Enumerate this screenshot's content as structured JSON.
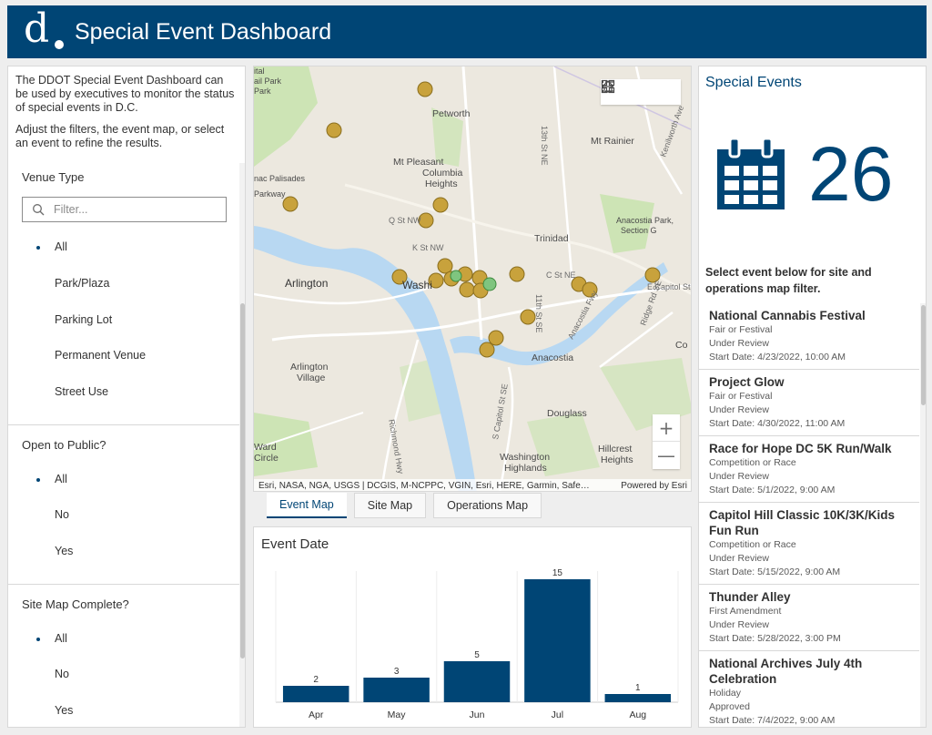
{
  "header": {
    "title": "Special Event Dashboard",
    "logo_letter": "d"
  },
  "intro": {
    "p1": "The DDOT Special Event Dashboard can be used by executives to monitor the status of special events in D.C.",
    "p2": "Adjust the filters, the event map, or select an event to refine the results."
  },
  "filters": {
    "venue_type": {
      "title": "Venue Type",
      "placeholder": "Filter...",
      "options": [
        "All",
        "Park/Plaza",
        "Parking Lot",
        "Permanent Venue",
        "Street Use"
      ]
    },
    "open_to_public": {
      "title": "Open to Public?",
      "options": [
        "All",
        "No",
        "Yes"
      ]
    },
    "site_map_complete": {
      "title": "Site Map Complete?",
      "options": [
        "All",
        "No",
        "Yes"
      ]
    }
  },
  "map": {
    "labels": [
      "Petworth",
      "Mt Rainier",
      "Mt Pleasant",
      "Columbia Heights",
      "Trinidad",
      "Anacostia Park, Section G",
      "Arlington",
      "Washington",
      "Anacostia",
      "Arlington Village",
      "Douglass",
      "Ward Circle",
      "Washington Highlands",
      "Hillcrest Heights",
      "K St NW",
      "C St NE",
      "Q St NW",
      "E Capitol St",
      "Anacostia Fwy",
      "Richmond Hwy",
      "S Capitol St SE",
      "13th St NE",
      "Kenilworth Ave",
      "Ridge Rd SE",
      "11th St SE",
      "Co",
      "Palisades Parkway",
      "Park"
    ],
    "attribution": "Esri, NASA, NGA, USGS | DCGIS, M-NCPPC, VGIN, Esri, HERE, Garmin, Safe…",
    "powered_by": "Powered by Esri",
    "zoom_in": "+",
    "zoom_out": "—",
    "tools": [
      "home-icon",
      "legend-icon",
      "basemap-icon"
    ]
  },
  "tabs": [
    {
      "label": "Event Map",
      "active": true
    },
    {
      "label": "Site Map",
      "active": false
    },
    {
      "label": "Operations Map",
      "active": false
    }
  ],
  "chart_title": "Event Date",
  "chart_data": {
    "type": "bar",
    "title": "Event Date",
    "categories": [
      "Apr",
      "May",
      "Jun",
      "Jul",
      "Aug"
    ],
    "values": [
      2,
      3,
      5,
      15,
      1
    ],
    "ylim": [
      0,
      16
    ],
    "grid": false,
    "bar_color": "#004575"
  },
  "right": {
    "title": "Special Events",
    "count": "26",
    "hint": "Select event below for site and operations map filter.",
    "events": [
      {
        "name": "National Cannabis Festival",
        "type": "Fair or Festival",
        "status": "Under Review",
        "start": "Start Date: 4/23/2022, 10:00 AM"
      },
      {
        "name": "Project Glow",
        "type": "Fair or Festival",
        "status": "Under Review",
        "start": "Start Date: 4/30/2022, 11:00 AM"
      },
      {
        "name": "Race for Hope DC 5K Run/Walk",
        "type": "Competition or Race",
        "status": "Under Review",
        "start": "Start Date: 5/1/2022, 9:00 AM"
      },
      {
        "name": "Capitol Hill Classic 10K/3K/Kids Fun Run",
        "type": "Competition or Race",
        "status": "Under Review",
        "start": "Start Date: 5/15/2022, 9:00 AM"
      },
      {
        "name": "Thunder Alley",
        "type": "First Amendment",
        "status": "Under Review",
        "start": "Start Date: 5/28/2022, 3:00 PM"
      },
      {
        "name": "National Archives July 4th Celebration",
        "type": "Holiday",
        "status": "Approved",
        "start": "Start Date: 7/4/2022, 9:00 AM"
      }
    ]
  },
  "colors": {
    "brand": "#004575",
    "marker": "#c8a23c",
    "water": "#b8d8f2",
    "park": "#cde4b5"
  }
}
